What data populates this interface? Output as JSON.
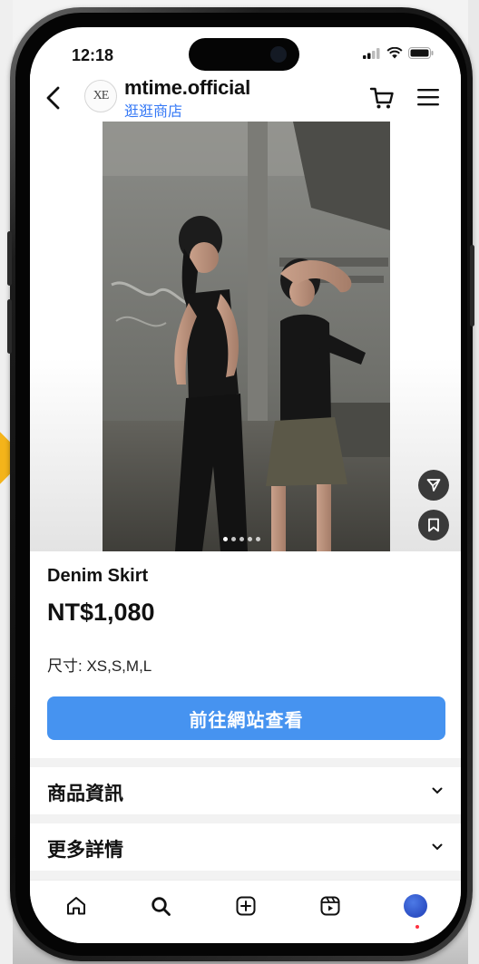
{
  "status_bar": {
    "time": "12:18"
  },
  "header": {
    "account_name": "mtime.official",
    "shop_label": "逛逛商店",
    "avatar_text": "ΧΕ"
  },
  "carousel": {
    "count": 5,
    "active_index": 0
  },
  "product": {
    "name": "Denim Skirt",
    "price": "NT$1,080",
    "size": "尺寸: XS,S,M,L",
    "cta_label": "前往網站查看"
  },
  "sections": [
    {
      "title": "商品資訊"
    },
    {
      "title": "更多詳情"
    }
  ],
  "tabbar": {
    "icons": [
      "home-icon",
      "search-icon",
      "create-post-icon",
      "reels-icon",
      "profile-avatar"
    ]
  },
  "colors": {
    "accent": "#4693f0",
    "link": "#3478f6",
    "text": "#111111"
  }
}
